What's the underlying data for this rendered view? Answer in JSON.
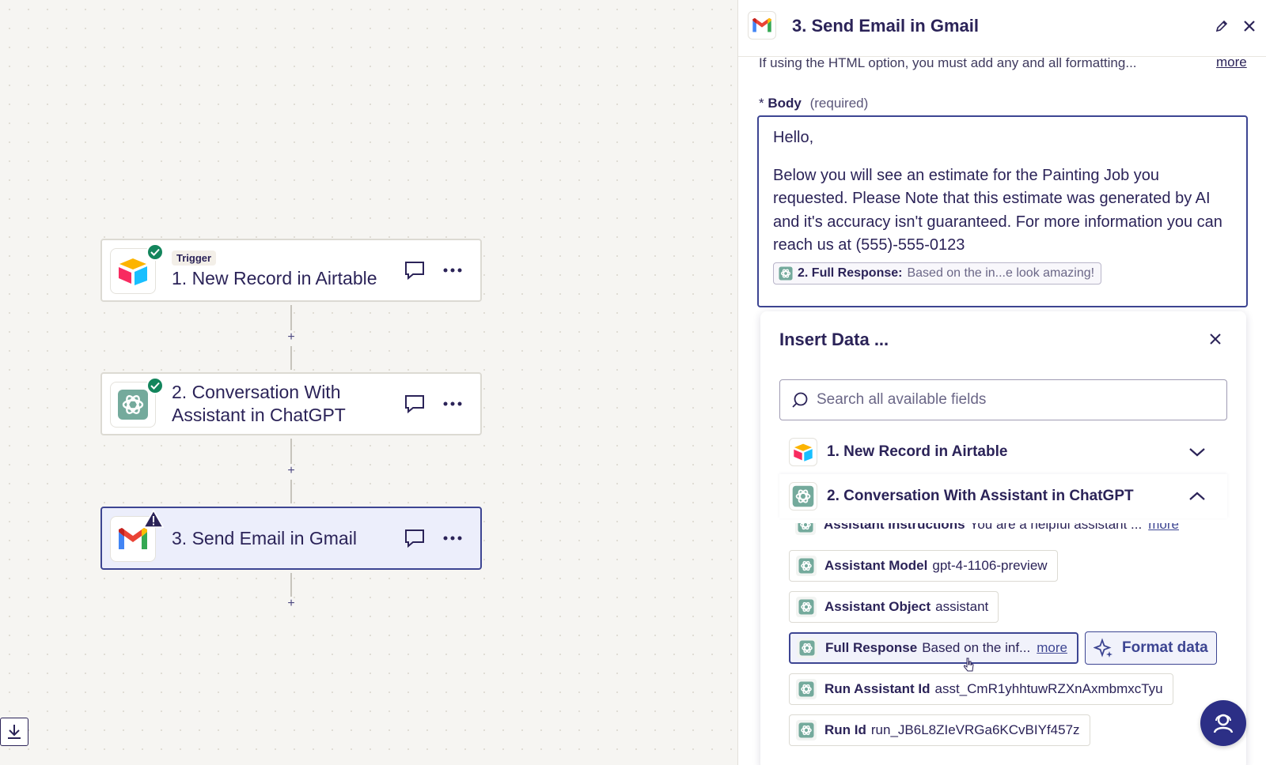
{
  "canvas": {
    "steps": [
      {
        "tag": "Trigger",
        "title": "1. New Record in Airtable",
        "app": "airtable-icon",
        "status": "success"
      },
      {
        "title_line1": "2. Conversation With",
        "title_line2": "Assistant in ChatGPT",
        "app": "chatgpt-icon",
        "status": "success"
      },
      {
        "title": "3. Send Email in Gmail",
        "app": "gmail-icon",
        "status": "warning"
      }
    ],
    "add_step": "+"
  },
  "panel": {
    "title": "3. Send Email in Gmail",
    "html_note": "If using the HTML option, you must add any and all formatting...",
    "more": "more",
    "body_label": "Body",
    "body_required_mark": "*",
    "body_required": "(required)",
    "body": {
      "greeting": "Hello,",
      "paragraph": "Below you will see an estimate for the Painting Job you requested.  Please Note that this estimate was generated by AI and it's accuracy isn't guaranteed.  For more information you can reach us at (555)-555-0123",
      "pill_label": "2. Full Response:",
      "pill_value": "Based on the in...e look amazing!"
    }
  },
  "insert_data": {
    "title": "Insert Data ...",
    "search_placeholder": "Search all available fields",
    "groups": [
      {
        "name": "1. New Record in Airtable",
        "expanded": false
      },
      {
        "name": "2. Conversation With Assistant in ChatGPT",
        "expanded": true
      }
    ],
    "items": [
      {
        "name": "Assistant Instructions",
        "value": "You are a helpful assistant ...",
        "more": "more"
      },
      {
        "name": "Assistant Model",
        "value": "gpt-4-1106-preview"
      },
      {
        "name": "Assistant Object",
        "value": "assistant"
      },
      {
        "name": "Full Response",
        "value": "Based on the inf...",
        "more": "more"
      },
      {
        "name": "Run Assistant Id",
        "value": "asst_CmR1yhhtuwRZXnAxmbmxcTyu"
      },
      {
        "name": "Run Id",
        "value": "run_JB6L8ZIeVRGa6KCvBIYf457z"
      }
    ],
    "format_data": "Format data"
  },
  "colors": {
    "accent": "#3d4592",
    "text": "#2b2358",
    "success": "#13855c",
    "canvas_bg": "#f6f5f2"
  }
}
